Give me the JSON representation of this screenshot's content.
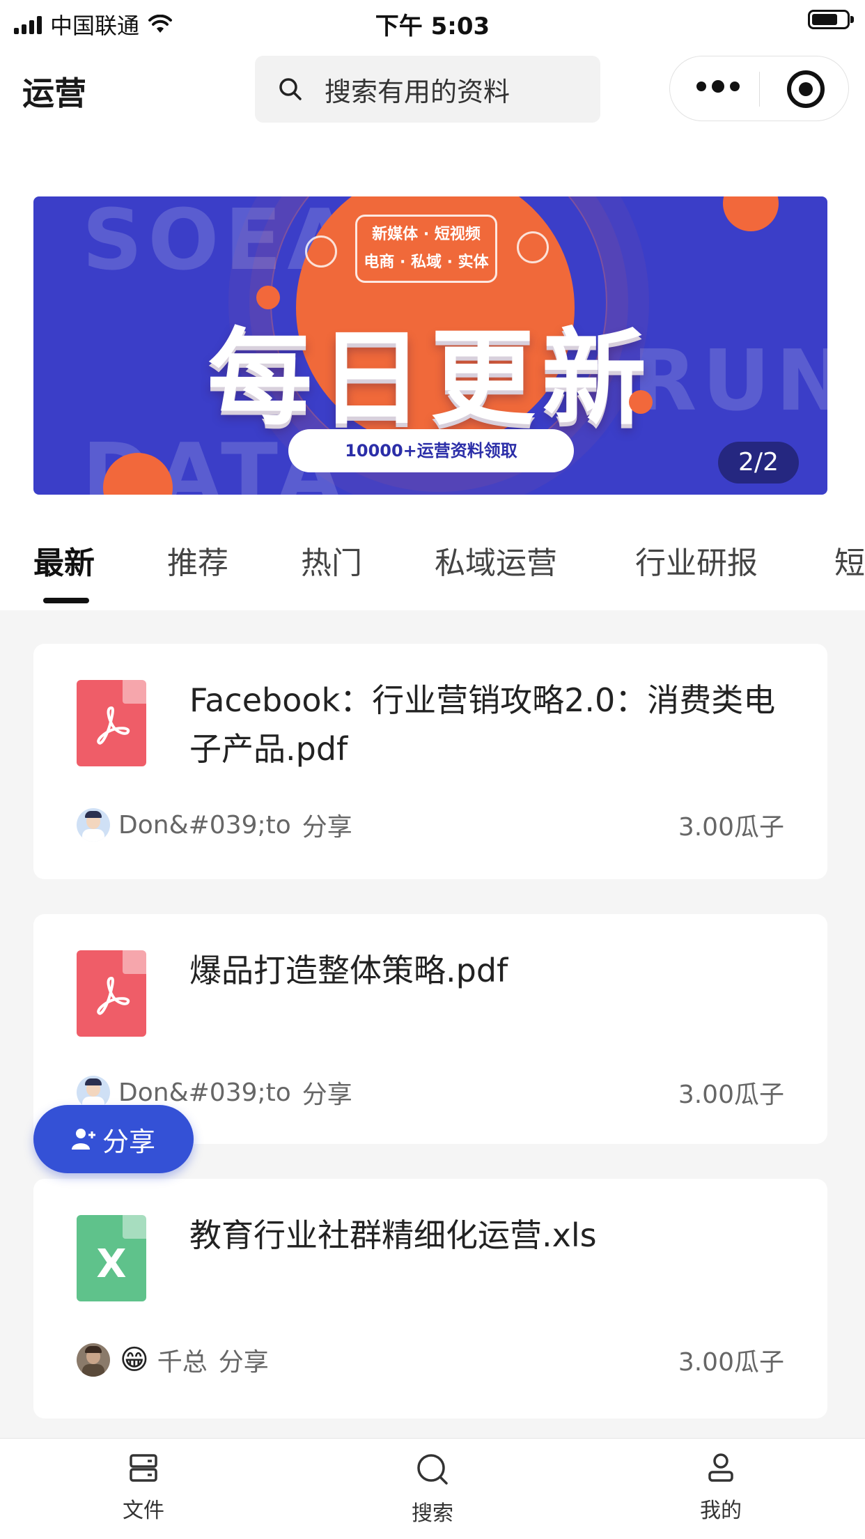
{
  "status_bar": {
    "carrier": "中国联通",
    "time": "下午 5:03"
  },
  "header": {
    "title": "运营",
    "search_placeholder": "搜索有用的资料"
  },
  "banner": {
    "bg_words": [
      "SOEA",
      "RUN",
      "DATA"
    ],
    "tags": [
      "新媒体 · 短视频",
      "电商 · 私域 · 实体"
    ],
    "headline": "每日更新",
    "pill": "10000+运营资料领取",
    "indicator": "2/2"
  },
  "tabs": [
    "最新",
    "推荐",
    "热门",
    "私域运营",
    "行业研报",
    "短"
  ],
  "active_tab": 0,
  "files": [
    {
      "type": "pdf",
      "title": "Facebook：行业营销攻略2.0：消费类电子产品.pdf",
      "author": "Don&#039;to",
      "share": "分享",
      "price": "3.00瓜子"
    },
    {
      "type": "pdf",
      "title": "爆品打造整体策略.pdf",
      "author": "Don&#039;to",
      "share": "分享",
      "price": "3.00瓜子"
    },
    {
      "type": "xls",
      "title": "教育行业社群精细化运营.xls",
      "author": "千总",
      "author_emoji": "😁",
      "share": "分享",
      "price": "3.00瓜子",
      "xls_glyph": "X"
    }
  ],
  "fab": {
    "label": "分享"
  },
  "bottom_nav": [
    {
      "label": "文件",
      "icon": "file-drawer-icon"
    },
    {
      "label": "搜索",
      "icon": "search-icon"
    },
    {
      "label": "我的",
      "icon": "user-icon"
    }
  ],
  "colors": {
    "accent": "#3451d6",
    "pdf": "#ef5d68",
    "xls": "#5fc28b",
    "banner_bg": "#3b3ec8",
    "banner_orange": "#f0693a"
  }
}
